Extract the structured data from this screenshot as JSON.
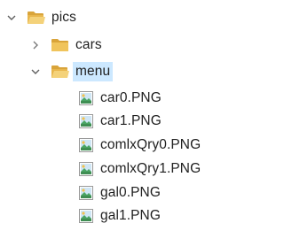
{
  "tree": {
    "root": {
      "label": "pics",
      "expanded": true,
      "icon": "folder-open-icon"
    },
    "cars": {
      "label": "cars",
      "expanded": false,
      "icon": "folder-icon"
    },
    "menu": {
      "label": "menu",
      "expanded": true,
      "selected": true,
      "icon": "folder-open-icon"
    },
    "files": [
      {
        "label": "car0.PNG",
        "icon": "image-file-icon"
      },
      {
        "label": "car1.PNG",
        "icon": "image-file-icon"
      },
      {
        "label": "comlxQry0.PNG",
        "icon": "image-file-icon"
      },
      {
        "label": "comlxQry1.PNG",
        "icon": "image-file-icon"
      },
      {
        "label": "gal0.PNG",
        "icon": "image-file-icon"
      },
      {
        "label": "gal1.PNG",
        "icon": "image-file-icon"
      }
    ]
  },
  "colors": {
    "selection": "#cce8ff",
    "folder": "#e8b64c",
    "chevron": "#5f5f5f"
  }
}
